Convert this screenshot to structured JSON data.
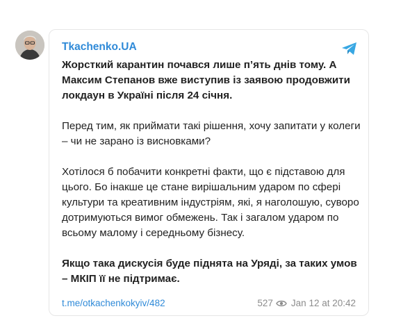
{
  "post": {
    "channel": "Tkachenko.UA",
    "paragraphs": [
      {
        "text": "Жорсткий карантин почався лише п’ять днів тому. А Максим Степанов вже виступив із заявою продовжити локдаун в Україні після 24 січня.",
        "bold": true
      },
      {
        "text": "Перед тим, як приймати такі рішення, хочу запитати у колеги – чи не зарано із висновками?",
        "bold": false
      },
      {
        "text": "Хотілося б побачити конкретні факти, що є підставою для цього. Бо інакше це стане вирішальним ударом по сфері культури та креативним індустріям, які, я наголошую, суворо дотримуються вимог обмежень. Так і загалом ударом по всьому малому і середньому бізнесу.",
        "bold": false
      },
      {
        "text": "Якщо така дискусія буде піднята на Уряді, за таких умов – МКІП її не підтримає.",
        "bold": true
      }
    ],
    "link": "t.me/otkachenkokyiv/482",
    "views": "527",
    "date": "Jan 12 at 20:42"
  },
  "colors": {
    "accent": "#2f8ad8",
    "meta": "#8c8c8c"
  },
  "icons": {
    "app": "telegram-icon",
    "views": "eye-icon"
  }
}
